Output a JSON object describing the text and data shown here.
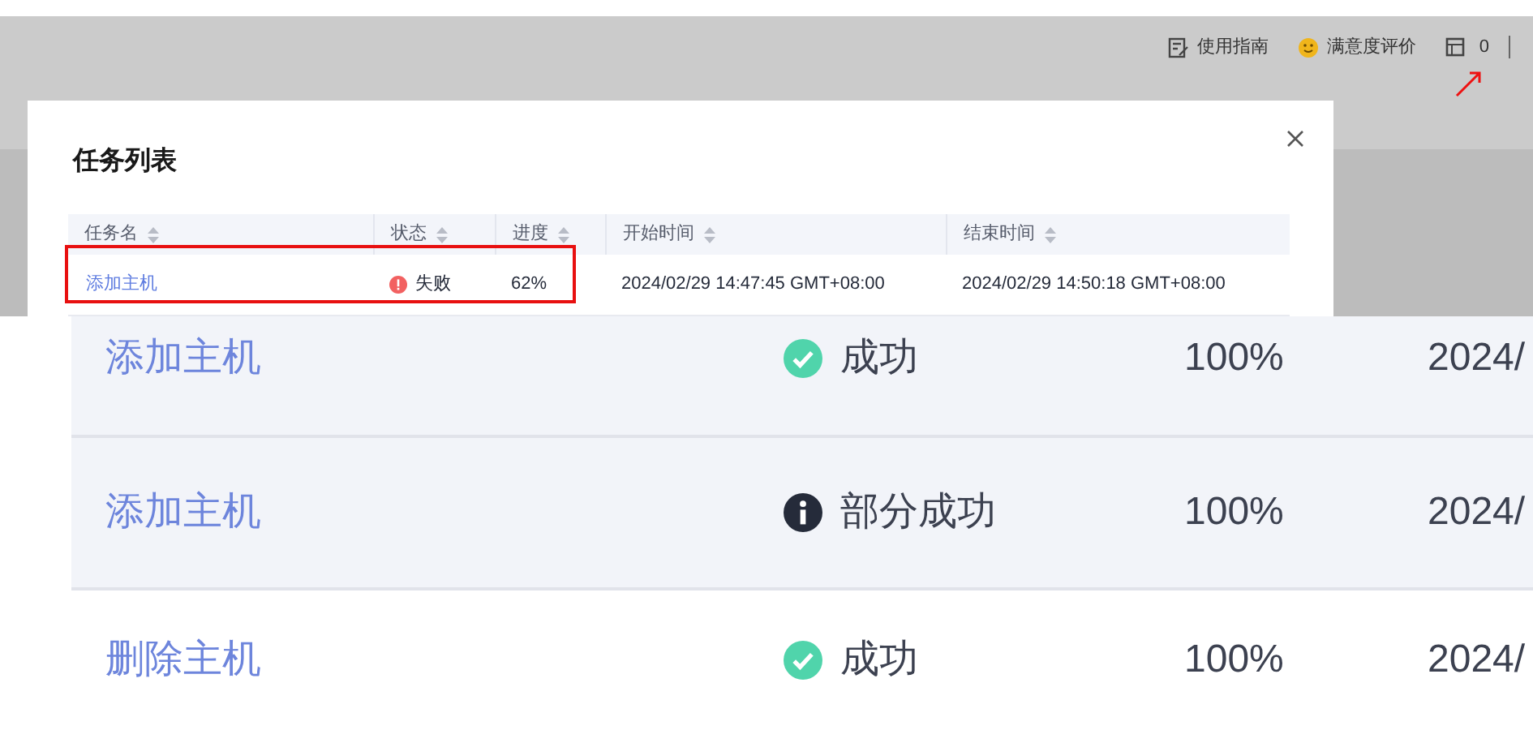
{
  "header": {
    "links": [
      {
        "label": "使用指南",
        "kind": "guide"
      },
      {
        "label": "满意度评价",
        "kind": "rating"
      }
    ],
    "task_count": "0"
  },
  "dialog": {
    "title": "任务列表",
    "table": {
      "columns": [
        "任务名",
        "状态",
        "进度",
        "开始时间",
        "结束时间"
      ],
      "rows": [
        {
          "name": "添加主机",
          "status": "失败",
          "kind": "error",
          "progress": "62%",
          "start": "2024/02/29 14:47:45 GMT+08:00",
          "end": "2024/02/29 14:50:18 GMT+08:00"
        }
      ]
    }
  },
  "zoomed_table": {
    "rows": [
      {
        "name": "添加主机",
        "status": "成功",
        "kind": "success",
        "progress": "100%",
        "start": "2024/",
        "highlighted": true
      },
      {
        "name": "添加主机",
        "status": "部分成功",
        "kind": "partial",
        "progress": "100%",
        "start": "2024/",
        "highlighted": true
      },
      {
        "name": "删除主机",
        "status": "成功",
        "kind": "success",
        "progress": "100%",
        "start": "2024/",
        "highlighted": false
      }
    ]
  }
}
